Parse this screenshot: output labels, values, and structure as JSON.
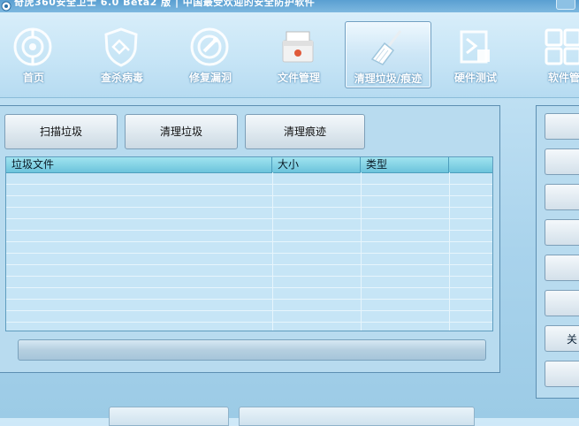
{
  "window": {
    "title": "奇虎360安全卫士 6.0 Beta2 版 | 中国最受欢迎的安全防护软件"
  },
  "toolbar": {
    "items": [
      {
        "label": "首页",
        "icon": "home-icon"
      },
      {
        "label": "查杀病毒",
        "icon": "shield-virus-icon"
      },
      {
        "label": "修复漏洞",
        "icon": "repair-icon"
      },
      {
        "label": "文件管理",
        "icon": "file-box-icon"
      },
      {
        "label": "清理垃圾/痕迹",
        "icon": "broom-icon"
      },
      {
        "label": "硬件测试",
        "icon": "hardware-icon"
      },
      {
        "label": "软件管",
        "icon": "grid-apps-icon"
      }
    ]
  },
  "actions": {
    "scan": "扫描垃圾",
    "clean": "清理垃圾",
    "traces": "清理痕迹"
  },
  "table": {
    "columns": [
      "垃圾文件",
      "大小",
      "类型",
      ""
    ]
  },
  "side": {
    "buttons": [
      "",
      "",
      "",
      "",
      "",
      "",
      "关",
      ""
    ]
  },
  "colors": {
    "accent": "#6cc4dc",
    "toolbar_bg": "#c7e5f6"
  }
}
